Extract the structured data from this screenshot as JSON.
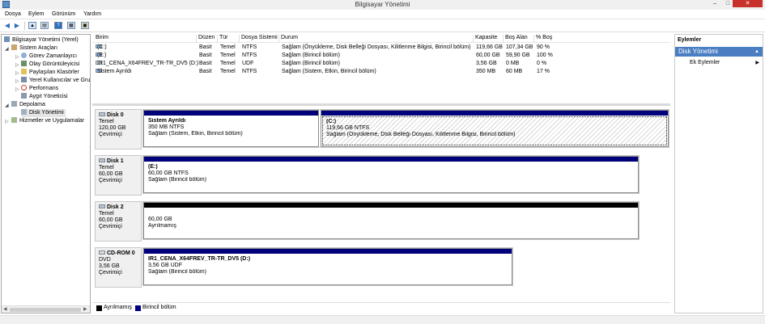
{
  "window": {
    "title": "Bilgisayar Yönetimi",
    "minimize": "–",
    "maximize": "□",
    "close": "✕"
  },
  "menu": [
    "Dosya",
    "Eylem",
    "Görünüm",
    "Yardım"
  ],
  "toolbar": {
    "back": "◀",
    "forward": "▶",
    "up": "▲",
    "show_hide": "▤",
    "help": "?",
    "properties": "▦",
    "extra": "▣"
  },
  "tree": {
    "items": [
      {
        "label": "Bilgisayar Yönetimi (Yerel)",
        "icon": "computer-icon"
      },
      {
        "label": "Sistem Araçları",
        "icon": "tools-icon"
      },
      {
        "label": "Görev Zamanlayıcı",
        "icon": "clock-icon"
      },
      {
        "label": "Olay Görüntüleyicisi",
        "icon": "event-viewer-icon"
      },
      {
        "label": "Paylaşılan Klasörler",
        "icon": "shared-folder-icon"
      },
      {
        "label": "Yerel Kullanıcılar ve Gru",
        "icon": "users-icon"
      },
      {
        "label": "Performans",
        "icon": "performance-icon"
      },
      {
        "label": "Aygıt Yöneticisi",
        "icon": "device-manager-icon"
      },
      {
        "label": "Depolama",
        "icon": "storage-icon"
      },
      {
        "label": "Disk Yönetimi",
        "icon": "disk-management-icon"
      },
      {
        "label": "Hizmetler ve Uygulamalar",
        "icon": "services-icon"
      }
    ],
    "expanders": {
      "collapsed": "▷",
      "expanded": "◢"
    },
    "scroll_left": "◀",
    "scroll_right": "▶"
  },
  "volume_table": {
    "headers": [
      "Birim",
      "Düzen",
      "Tür",
      "Dosya Sistemi",
      "Durum",
      "Kapasite",
      "Boş Alan",
      "% Boş"
    ],
    "rows": [
      [
        "(C:)",
        "Basit",
        "Temel",
        "NTFS",
        "Sağlam (Önyükleme, Disk Belleği Dosyası, Kilitlenme Bilgisi, Birincil bölüm)",
        "119,66 GB",
        "107,34 GB",
        "90 %"
      ],
      [
        "(E:)",
        "Basit",
        "Temel",
        "NTFS",
        "Sağlam (Birincil bölüm)",
        "60,00 GB",
        "59,90 GB",
        "100 %"
      ],
      [
        "IR1_CENA_X64FREV_TR-TR_DV5 (D:)",
        "Basit",
        "Temel",
        "UDF",
        "Sağlam (Birincil bölüm)",
        "3,56 GB",
        "0 MB",
        "0 %"
      ],
      [
        "Sistem Ayrıldı",
        "Basit",
        "Temel",
        "NTFS",
        "Sağlam (Sistem, Etkin, Birincil bölüm)",
        "350 MB",
        "60 MB",
        "17 %"
      ]
    ]
  },
  "disks": [
    {
      "name": "Disk 0",
      "type": "Temel",
      "size": "120,00 GB",
      "status": "Çevrimiçi",
      "partitions": [
        {
          "name": "Sistem Ayrıldı",
          "size": "350 MB NTFS",
          "status": "Sağlam (Sistem, Etkin, Birincil bölüm)",
          "kind": "primary"
        },
        {
          "name": "(C:)",
          "size": "119,66 GB NTFS",
          "status": "Sağlam (Önyükleme, Disk Belleği Dosyası, Kilitlenme Bilgisi, Birincil bölüm)",
          "kind": "primary"
        }
      ]
    },
    {
      "name": "Disk 1",
      "type": "Temel",
      "size": "60,00 GB",
      "status": "Çevrimiçi",
      "partitions": [
        {
          "name": "(E:)",
          "size": "60,00 GB NTFS",
          "status": "Sağlam (Birincil bölüm)",
          "kind": "primary"
        }
      ]
    },
    {
      "name": "Disk 2",
      "type": "Temel",
      "size": "60,00 GB",
      "status": "Çevrimiçi",
      "partitions": [
        {
          "name": "",
          "size": "60,00 GB",
          "status": "Ayrılmamış",
          "kind": "unallocated"
        }
      ]
    },
    {
      "name": "CD-ROM 0",
      "type": "DVD",
      "size": "3,56 GB",
      "status": "Çevrimiçi",
      "partitions": [
        {
          "name": "IR1_CENA_X64FREV_TR-TR_DV5  (D:)",
          "size": "3,56 GB UDF",
          "status": "Sağlam (Birincil bölüm)",
          "kind": "primary"
        }
      ]
    }
  ],
  "legend": {
    "unallocated": "Ayrılmamış",
    "primary": "Birincil bölüm"
  },
  "actions": {
    "header": "Eylemler",
    "section": "Disk Yönetimi",
    "collapse": "▲",
    "more": "Ek Eylemler",
    "more_arrow": "▶"
  },
  "colors": {
    "primary": "#00007b",
    "unallocated": "#000000",
    "accent": "#4a7ec2"
  }
}
